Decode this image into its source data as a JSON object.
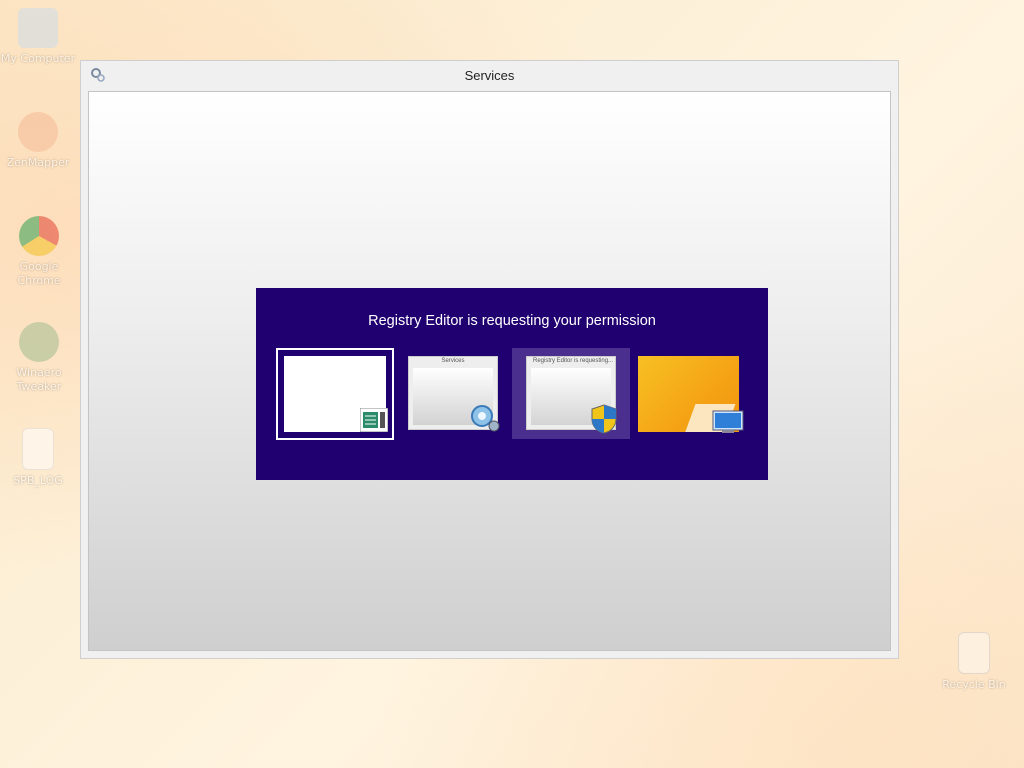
{
  "desktop": {
    "icons": [
      {
        "label": "My Computer",
        "icon": "computer-icon"
      },
      {
        "label": "ZenMapper",
        "icon": "app-shortcut-icon"
      },
      {
        "label": "Google Chrome",
        "icon": "chrome-icon"
      },
      {
        "label": "Winaero Tweaker",
        "icon": "tweaker-icon"
      },
      {
        "label": "SPB_LOG",
        "icon": "file-icon"
      },
      {
        "label": "Recycle Bin",
        "icon": "recycle-bin-icon"
      }
    ]
  },
  "window": {
    "title": "Services",
    "icon": "services-gear-icon"
  },
  "switcher": {
    "title": "Registry Editor is requesting your permission",
    "thumbnails": [
      {
        "name": "blank-window",
        "badge": "notepad-icon",
        "selected": true
      },
      {
        "name": "services-window",
        "title": "Services",
        "badge": "gear-icon"
      },
      {
        "name": "registry-editor-window",
        "title": "Registry Editor is requesting...",
        "badge": "uac-shield-icon",
        "highlighted": true
      },
      {
        "name": "desktop",
        "badge": "desktop-monitor-icon"
      }
    ]
  },
  "colors": {
    "switcher_bg": "#200070",
    "highlight": "#4a2f8f"
  }
}
